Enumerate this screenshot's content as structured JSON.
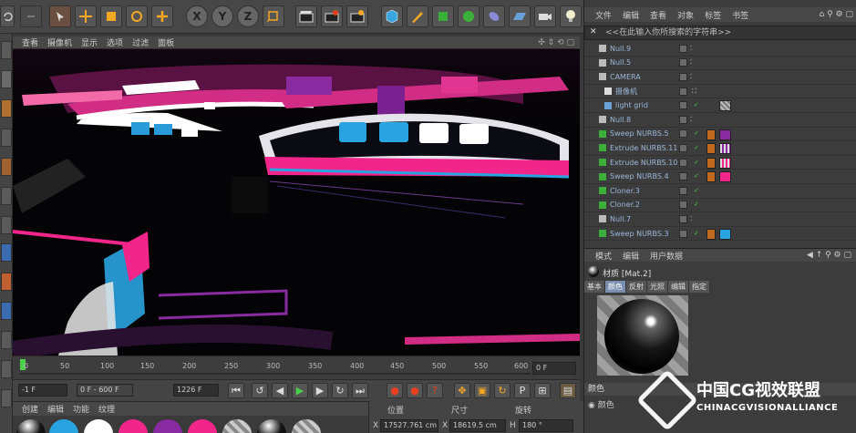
{
  "colors": {
    "accent": "#f2258a",
    "blue": "#2aa4e0",
    "purple": "#8a2aa0"
  },
  "toolbar": {
    "items": [
      "undo-icon",
      "redo-icon",
      "select-arrow-icon",
      "move-icon",
      "scale-icon",
      "rotate-icon",
      "add-icon",
      "x-axis-icon",
      "y-axis-icon",
      "z-axis-icon",
      "coord-system-icon",
      "render-view-icon",
      "render-picture-icon",
      "render-settings-icon",
      "cube-icon",
      "pen-icon",
      "subdivide-icon",
      "mograph-icon",
      "deformer-icon",
      "floor-icon",
      "camera-icon",
      "light-icon"
    ],
    "axes": [
      "X",
      "Y",
      "Z"
    ]
  },
  "viewport": {
    "menu": [
      "查看",
      "摄像机",
      "显示",
      "选项",
      "过滤",
      "面板"
    ]
  },
  "timeline": {
    "ticks": [
      "0",
      "50",
      "100",
      "150",
      "200",
      "250",
      "300",
      "350",
      "400",
      "450",
      "500",
      "550",
      "600"
    ],
    "current_frame": "0 F",
    "current_frame_value": 0,
    "max_frame": 600
  },
  "controls": {
    "start": "-1 F",
    "range": "0 F - 600 F",
    "end": "1226 F"
  },
  "material_bar": {
    "menu": [
      "创建",
      "编辑",
      "功能",
      "纹理"
    ]
  },
  "coordinates": {
    "headers": [
      "位置",
      "尺寸",
      "旋转"
    ],
    "x_label": "X",
    "x_pos": "17527.761 cm",
    "x_size_label": "X",
    "x_size": "18619.5 cm",
    "h_label": "H",
    "h_rot": "180 °"
  },
  "objects_panel": {
    "menu": [
      "文件",
      "编辑",
      "查看",
      "对象",
      "标签",
      "书签"
    ],
    "search_placeholder": "<<在此输入你所搜索的字符串>>",
    "rows": [
      {
        "name": "Null.9",
        "tags": []
      },
      {
        "name": "Null.5",
        "tags": []
      },
      {
        "name": "CAMERA",
        "tags": []
      },
      {
        "name": "摄像机",
        "tags": []
      },
      {
        "name": "light grid",
        "tags": [
          "check",
          "gray"
        ]
      },
      {
        "name": "Null.8",
        "tags": []
      },
      {
        "name": "Sweep NURBS.5",
        "tags": [
          "check",
          "pink",
          "purple"
        ]
      },
      {
        "name": "Extrude NURBS.11",
        "tags": [
          "check",
          "pink",
          "stripe"
        ]
      },
      {
        "name": "Extrude NURBS.10",
        "tags": [
          "check",
          "pink",
          "stripe2"
        ]
      },
      {
        "name": "Sweep NURBS.4",
        "tags": [
          "check",
          "pink",
          "pink"
        ]
      },
      {
        "name": "Cloner.3",
        "tags": [
          "check"
        ]
      },
      {
        "name": "Cloner.2",
        "tags": [
          "check"
        ]
      },
      {
        "name": "Null.7",
        "tags": []
      },
      {
        "name": "Sweep NURBS.3",
        "tags": [
          "check",
          "pink",
          "blue"
        ]
      }
    ]
  },
  "attributes": {
    "menu": [
      "模式",
      "编辑",
      "用户数据"
    ],
    "title": "材质 [Mat.2]",
    "tabs": [
      "基本",
      "颜色",
      "反射",
      "光照",
      "编辑",
      "指定"
    ],
    "active_tab": "颜色",
    "color_header": "颜色",
    "color_label": "颜色"
  },
  "watermark": {
    "line1": "中国CG视效联盟",
    "line2": "CHINACGVISIONALLIANCE"
  }
}
